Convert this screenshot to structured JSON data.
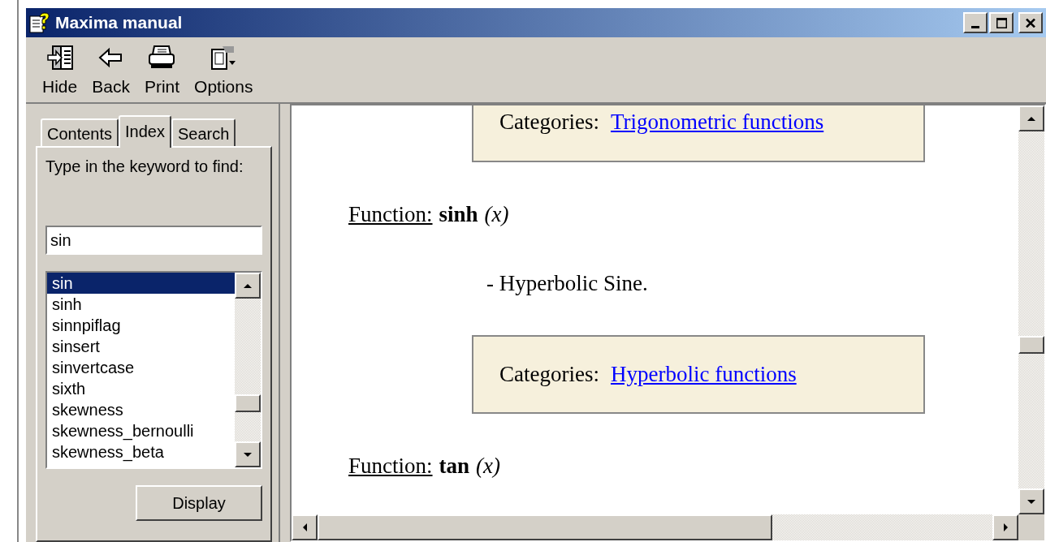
{
  "window": {
    "title": "Maxima manual"
  },
  "toolbar": [
    {
      "kind": "hide",
      "label": "Hide"
    },
    {
      "kind": "back",
      "label": "Back"
    },
    {
      "kind": "print",
      "label": "Print"
    },
    {
      "kind": "options",
      "label": "Options"
    }
  ],
  "tabs": [
    {
      "label": "Contents",
      "selected": false
    },
    {
      "label": "Index",
      "selected": true
    },
    {
      "label": "Search",
      "selected": false
    }
  ],
  "index": {
    "prompt": "Type in the keyword to find:",
    "keyword": "sin",
    "items": [
      {
        "label": "sin",
        "selected": true
      },
      {
        "label": "sinh",
        "selected": false
      },
      {
        "label": "sinnpiflag",
        "selected": false
      },
      {
        "label": "sinsert",
        "selected": false
      },
      {
        "label": "sinvertcase",
        "selected": false
      },
      {
        "label": "sixth",
        "selected": false
      },
      {
        "label": "skewness",
        "selected": false
      },
      {
        "label": "skewness_bernoulli",
        "selected": false
      },
      {
        "label": "skewness_beta",
        "selected": false
      }
    ],
    "button": "Display"
  },
  "content": [
    {
      "kind": "categories",
      "cut": true,
      "label": "Categories:",
      "link": "Trigonometric functions"
    },
    {
      "kind": "function",
      "label": "Function:",
      "name": "sinh",
      "args": "(x)"
    },
    {
      "kind": "description",
      "text": "- Hyperbolic Sine."
    },
    {
      "kind": "categories",
      "cut": false,
      "label": "Categories:",
      "link": "Hyperbolic functions"
    },
    {
      "kind": "function",
      "label": "Function:",
      "name": "tan",
      "args": "(x)"
    }
  ]
}
